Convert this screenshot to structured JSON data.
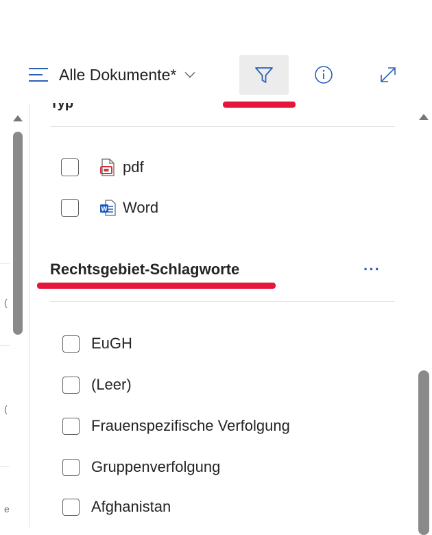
{
  "toolbar": {
    "view_label": "Alle Dokumente*",
    "icons": {
      "menu": "hamburger-menu-icon",
      "chevron": "chevron-down-icon",
      "filter": "filter-funnel-icon",
      "info": "info-circle-icon",
      "expand": "expand-diagonal-icon"
    }
  },
  "left_list": {
    "fragments": [
      "(",
      "(",
      "e"
    ]
  },
  "filter_panel": {
    "clipped_section_heading": "Typ",
    "type_options": [
      {
        "label": "pdf",
        "icon": "pdf-file-icon",
        "checked": false
      },
      {
        "label": "Word",
        "icon": "word-file-icon",
        "checked": false
      }
    ],
    "section_title": "Rechtsgebiet-Schlagworte",
    "more_label": "···",
    "keyword_options": [
      {
        "label": "EuGH",
        "checked": false
      },
      {
        "label": "(Leer)",
        "checked": false
      },
      {
        "label": "Frauenspezifische Verfolgung",
        "checked": false
      },
      {
        "label": "Gruppenverfolgung",
        "checked": false
      },
      {
        "label": "Afghanistan",
        "checked": false
      }
    ]
  },
  "colors": {
    "accent_blue": "#2b5fb4",
    "annotation_red": "#e5163a",
    "pdf_red": "#d13438",
    "word_blue": "#185abd",
    "selected_bg": "#ececec"
  }
}
